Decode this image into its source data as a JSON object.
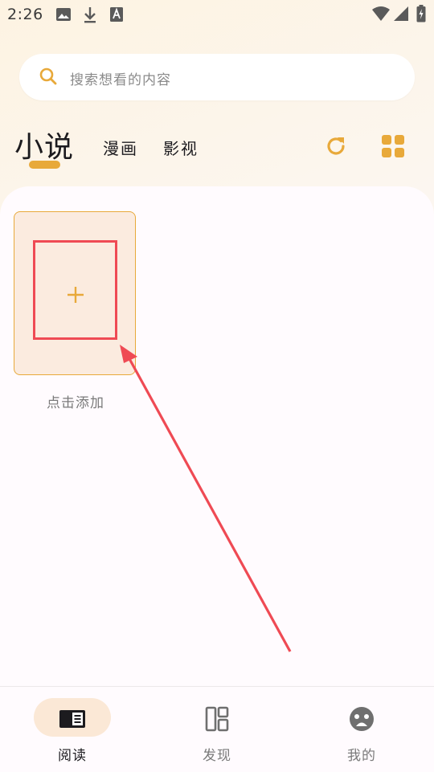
{
  "status_bar": {
    "time": "2:26",
    "icons": [
      "image-icon",
      "download-icon",
      "text-a-icon",
      "wifi-icon",
      "signal-icon",
      "battery-charging-icon"
    ]
  },
  "search": {
    "placeholder": "搜索想看的内容",
    "icon": "search-icon"
  },
  "category_tabs": {
    "active": "小说",
    "items": [
      {
        "label": "小说",
        "selected": true
      },
      {
        "label": "漫画",
        "selected": false
      },
      {
        "label": "影视",
        "selected": false
      }
    ]
  },
  "toolbar": {
    "refresh_icon": "refresh-icon",
    "layout_icon": "grid-icon"
  },
  "bookshelf": {
    "add_label": "点击添加",
    "add_icon": "plus-icon"
  },
  "bottom_nav": {
    "items": [
      {
        "label": "阅读",
        "icon": "book-icon",
        "active": true
      },
      {
        "label": "发现",
        "icon": "dashboard-icon",
        "active": false
      },
      {
        "label": "我的",
        "icon": "face-icon",
        "active": false
      }
    ]
  },
  "colors": {
    "accent": "#e8a93a",
    "annotation": "#ef4a54",
    "card_bg": "#fbebdf",
    "nav_pill": "#fbe8d6"
  }
}
